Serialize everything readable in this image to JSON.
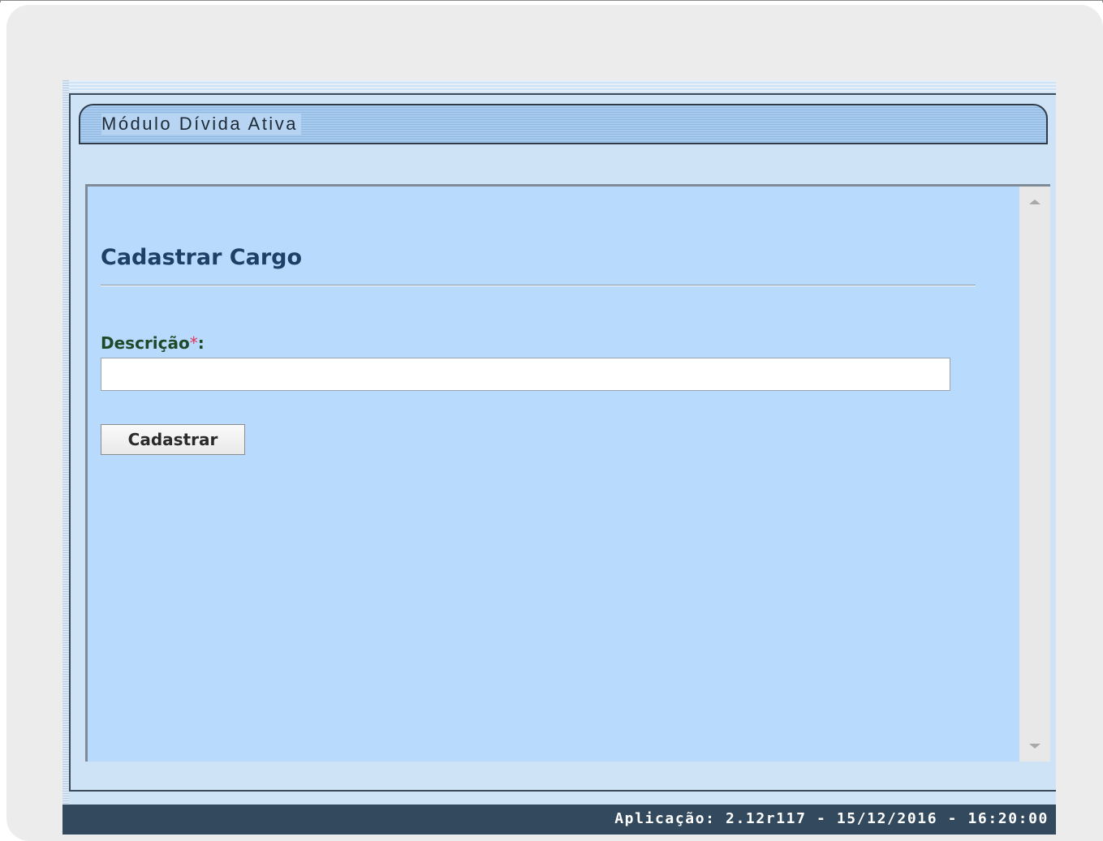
{
  "module": {
    "title": "Módulo Dívida Ativa"
  },
  "form": {
    "title": "Cadastrar Cargo",
    "description_label": "Descrição",
    "required_marker": "*",
    "label_suffix": ":",
    "description_value": "",
    "description_placeholder": "",
    "submit_label": "Cadastrar"
  },
  "status": {
    "app_info": "Aplicação: 2.12r117 - 15/12/2016 - 16:20:00"
  },
  "colors": {
    "status_bar": "#334a5e",
    "content_bg": "#b8dafd",
    "title_color": "#1f4066",
    "label_color": "#1f4a2a",
    "required_color": "#e0365a"
  }
}
